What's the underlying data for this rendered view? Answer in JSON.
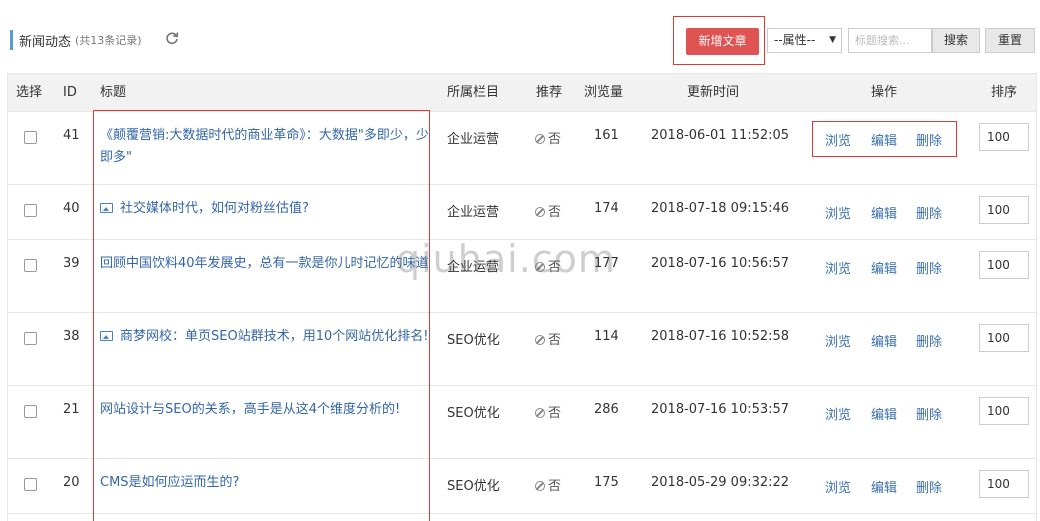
{
  "header": {
    "title": "新闻动态",
    "count": "(共13条记录)",
    "refresh_icon": "refresh-icon",
    "add_label": "新增文章",
    "attr_select": "--属性--",
    "search_placeholder": "标题搜索...",
    "search_label": "搜索",
    "reset_label": "重置"
  },
  "columns": [
    "选择",
    "ID",
    "标题",
    "所属栏目",
    "推荐",
    "浏览量",
    "更新时间",
    "操作",
    "排序"
  ],
  "rows": [
    {
      "id": "41",
      "title": "《颠覆营销:大数据时代的商业革命》：大数据\"多即少，少即多\"",
      "has_image": false,
      "category": "企业运营",
      "recommend": "否",
      "views": "161",
      "updated": "2018-06-01 11:52:05",
      "sort": "100"
    },
    {
      "id": "40",
      "title": "社交媒体时代，如何对粉丝估值?",
      "has_image": true,
      "category": "企业运营",
      "recommend": "否",
      "views": "174",
      "updated": "2018-07-18 09:15:46",
      "sort": "100"
    },
    {
      "id": "39",
      "title": "回顾中国饮料40年发展史，总有一款是你儿时记忆的味道",
      "has_image": false,
      "category": "企业运营",
      "recommend": "否",
      "views": "177",
      "updated": "2018-07-16 10:56:57",
      "sort": "100"
    },
    {
      "id": "38",
      "title": "商梦网校：单页SEO站群技术，用10个网站优化排名!",
      "has_image": true,
      "category": "SEO优化",
      "recommend": "否",
      "views": "114",
      "updated": "2018-07-16 10:52:58",
      "sort": "100"
    },
    {
      "id": "21",
      "title": "网站设计与SEO的关系，高手是从这4个维度分析的!",
      "has_image": false,
      "category": "SEO优化",
      "recommend": "否",
      "views": "286",
      "updated": "2018-07-16 10:53:57",
      "sort": "100"
    },
    {
      "id": "20",
      "title": "CMS是如何应运而生的?",
      "has_image": false,
      "category": "SEO优化",
      "recommend": "否",
      "views": "175",
      "updated": "2018-05-29 09:32:22",
      "sort": "100"
    }
  ],
  "actions": {
    "view": "浏览",
    "edit": "编辑",
    "delete": "删除"
  },
  "watermark": "qiuhai.com",
  "colors": {
    "accent": "#e05353",
    "link": "#3366aa",
    "highlight_frame": "#d93a3a"
  }
}
